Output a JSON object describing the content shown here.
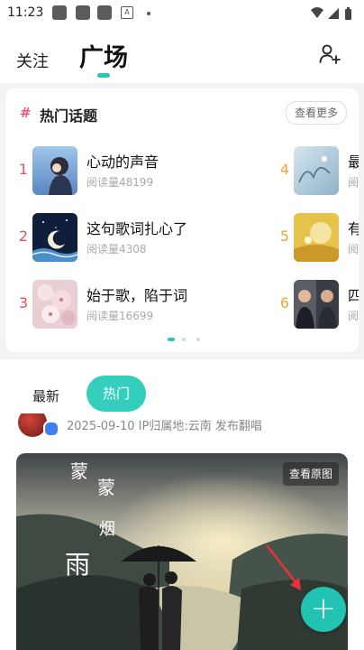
{
  "status_bar": {
    "time": "11:23"
  },
  "nav": {
    "follow": "关注",
    "square": "广场"
  },
  "hot_topics": {
    "hash": "#",
    "title": "热门话题",
    "see_more": "查看更多",
    "items": [
      {
        "rank": "1",
        "title": "心动的声音",
        "reads": "阅读量48199"
      },
      {
        "rank": "2",
        "title": "这句歌词扎心了",
        "reads": "阅读量4308"
      },
      {
        "rank": "3",
        "title": "始于歌，陷于词",
        "reads": "阅读量16699"
      },
      {
        "rank": "4",
        "title": "最",
        "reads": "阅"
      },
      {
        "rank": "5",
        "title": "有",
        "reads": "阅"
      },
      {
        "rank": "6",
        "title": "四",
        "reads": "阅"
      }
    ]
  },
  "feed": {
    "tab_latest": "最新",
    "tab_hot": "热门",
    "post_meta": "2025-09-10 IP归属地:云南 发布翻唱",
    "view_original": "查看原图",
    "poem": {
      "c1": "蒙",
      "c2": "蒙",
      "c3": "烟",
      "c4": "雨"
    }
  },
  "colors": {
    "accent": "#2cc6b3",
    "rank_top": "#e65061",
    "rank_other": "#f3a431"
  },
  "icons": [
    "add-user-icon",
    "plus-icon",
    "wifi-icon",
    "signal-icon",
    "battery-icon"
  ]
}
